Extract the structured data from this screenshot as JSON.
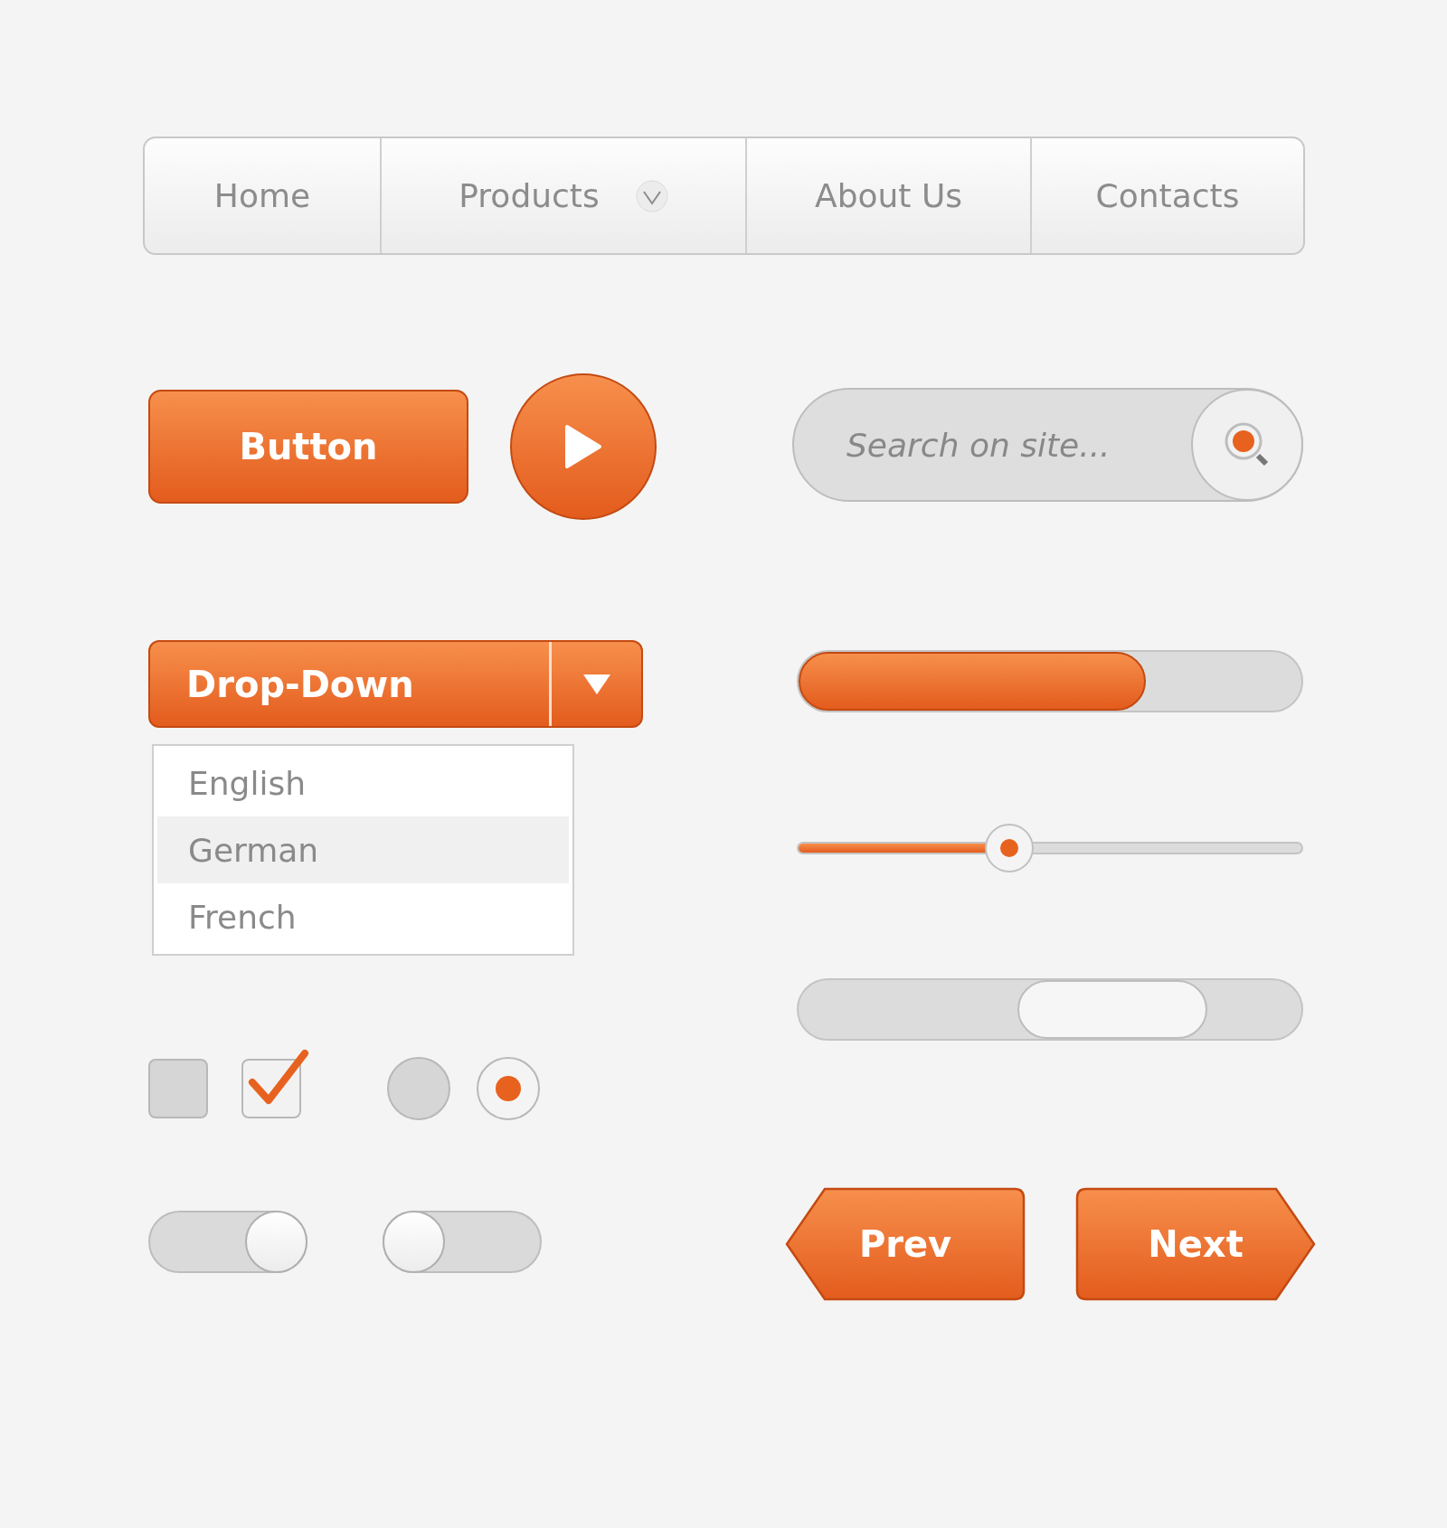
{
  "nav": {
    "tabs": [
      {
        "label": "Home",
        "kind": "link"
      },
      {
        "label": "Products",
        "kind": "menu"
      },
      {
        "label": "About Us",
        "kind": "link"
      },
      {
        "label": "Contacts",
        "kind": "link"
      }
    ]
  },
  "button": {
    "label": "Button"
  },
  "search": {
    "placeholder": "Search on site..."
  },
  "dropdown": {
    "label": "Drop-Down",
    "expanded": true,
    "options": [
      {
        "label": "English",
        "selected": false
      },
      {
        "label": "German",
        "selected": true
      },
      {
        "label": "French",
        "selected": false
      }
    ]
  },
  "progress": {
    "level": 0.69
  },
  "slider": {
    "level": 0.42
  },
  "checkboxes": [
    {
      "checked": false
    },
    {
      "checked": true
    }
  ],
  "radios": [
    {
      "selected": false
    },
    {
      "selected": true
    }
  ],
  "toggles": [
    {
      "on": true
    },
    {
      "on": false
    }
  ],
  "pager": {
    "prev": "Prev",
    "next": "Next"
  }
}
